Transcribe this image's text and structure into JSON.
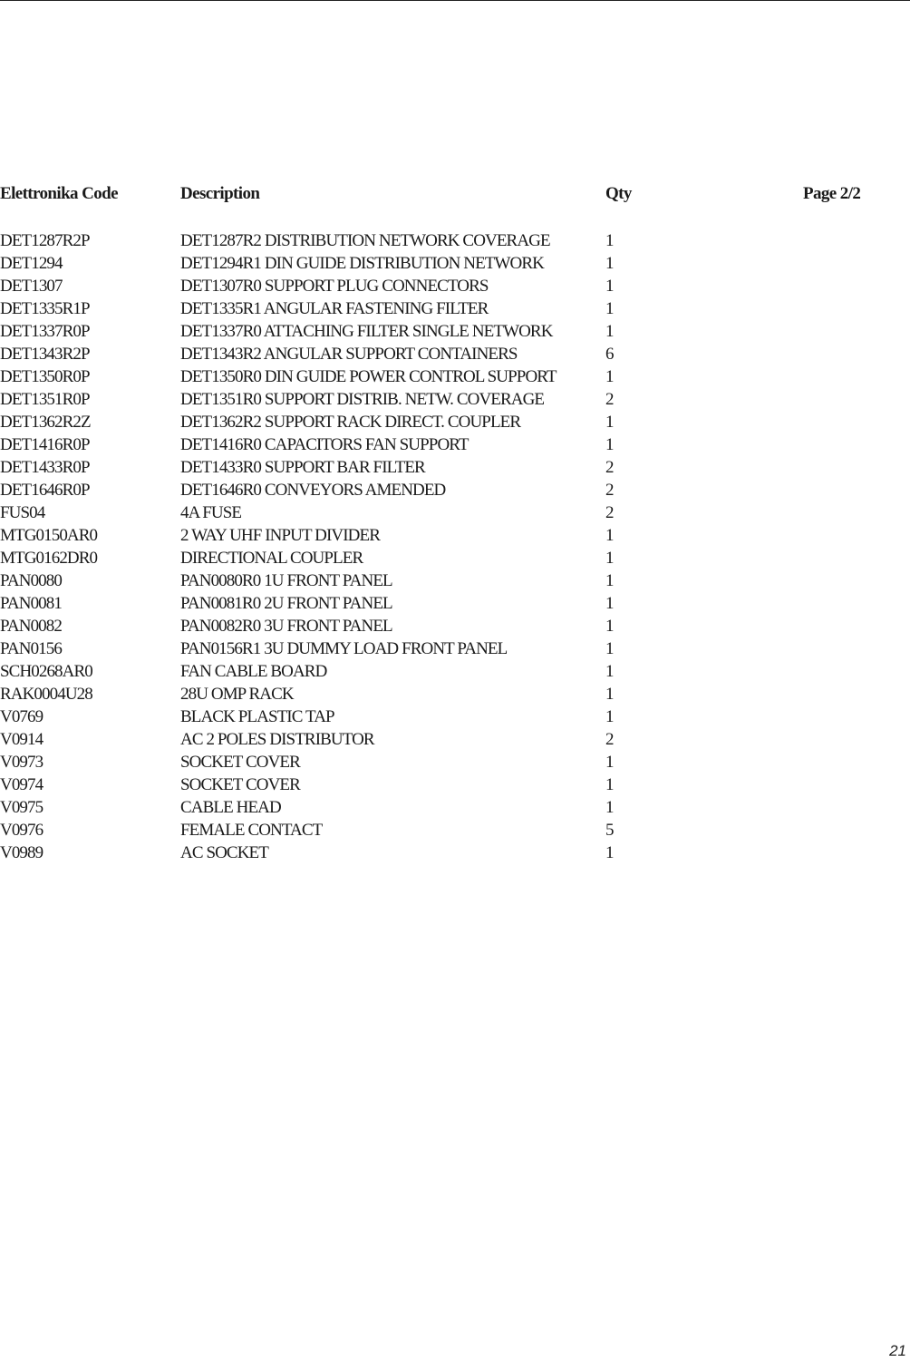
{
  "header": {
    "code_label": "Elettronika Code",
    "description_label": "Description",
    "qty_label": "Qty",
    "page_indicator": "Page 2/2"
  },
  "items": [
    {
      "code": "DET1287R2P",
      "description": "DET1287R2 DISTRIBUTION NETWORK COVERAGE",
      "qty": "1"
    },
    {
      "code": "DET1294",
      "description": "DET1294R1 DIN GUIDE DISTRIBUTION NETWORK",
      "qty": "1"
    },
    {
      "code": "DET1307",
      "description": "DET1307R0 SUPPORT PLUG CONNECTORS",
      "qty": "1"
    },
    {
      "code": "DET1335R1P",
      "description": "DET1335R1 ANGULAR FASTENING FILTER",
      "qty": "1"
    },
    {
      "code": "DET1337R0P",
      "description": "DET1337R0 ATTACHING FILTER SINGLE NETWORK",
      "qty": "1"
    },
    {
      "code": "DET1343R2P",
      "description": "DET1343R2 ANGULAR SUPPORT CONTAINERS",
      "qty": "6"
    },
    {
      "code": "DET1350R0P",
      "description": "DET1350R0 DIN GUIDE POWER CONTROL SUPPORT",
      "qty": "1"
    },
    {
      "code": "DET1351R0P",
      "description": "DET1351R0 SUPPORT DISTRIB. NETW. COVERAGE",
      "qty": "2"
    },
    {
      "code": "DET1362R2Z",
      "description": "DET1362R2 SUPPORT RACK DIRECT. COUPLER",
      "qty": "1"
    },
    {
      "code": "DET1416R0P",
      "description": "DET1416R0 CAPACITORS FAN SUPPORT",
      "qty": "1"
    },
    {
      "code": "DET1433R0P",
      "description": "DET1433R0 SUPPORT BAR FILTER",
      "qty": "2"
    },
    {
      "code": "DET1646R0P",
      "description": "DET1646R0 CONVEYORS AMENDED",
      "qty": "2"
    },
    {
      "code": "FUS04",
      "description": "4A FUSE",
      "qty": "2"
    },
    {
      "code": "MTG0150AR0",
      "description": "2 WAY UHF INPUT DIVIDER",
      "qty": "1"
    },
    {
      "code": "MTG0162DR0",
      "description": "DIRECTIONAL COUPLER",
      "qty": "1"
    },
    {
      "code": "PAN0080",
      "description": "PAN0080R0 1U FRONT PANEL",
      "qty": "1"
    },
    {
      "code": "PAN0081",
      "description": "PAN0081R0 2U FRONT PANEL",
      "qty": "1"
    },
    {
      "code": "PAN0082",
      "description": "PAN0082R0 3U FRONT PANEL",
      "qty": "1"
    },
    {
      "code": "PAN0156",
      "description": "PAN0156R1 3U DUMMY LOAD FRONT PANEL",
      "qty": "1"
    },
    {
      "code": "SCH0268AR0",
      "description": "FAN CABLE BOARD",
      "qty": "1"
    },
    {
      "code": "RAK0004U28",
      "description": "28U OMP RACK",
      "qty": "1"
    },
    {
      "code": "V0769",
      "description": "BLACK PLASTIC TAP",
      "qty": "1"
    },
    {
      "code": "V0914",
      "description": "AC 2 POLES DISTRIBUTOR",
      "qty": "2"
    },
    {
      "code": "V0973",
      "description": "SOCKET COVER",
      "qty": "1"
    },
    {
      "code": "V0974",
      "description": "SOCKET COVER",
      "qty": "1"
    },
    {
      "code": "V0975",
      "description": "CABLE HEAD",
      "qty": "1"
    },
    {
      "code": "V0976",
      "description": "FEMALE CONTACT",
      "qty": "5"
    },
    {
      "code": "V0989",
      "description": "AC SOCKET",
      "qty": "1"
    }
  ],
  "footer": {
    "page_number": "21"
  }
}
